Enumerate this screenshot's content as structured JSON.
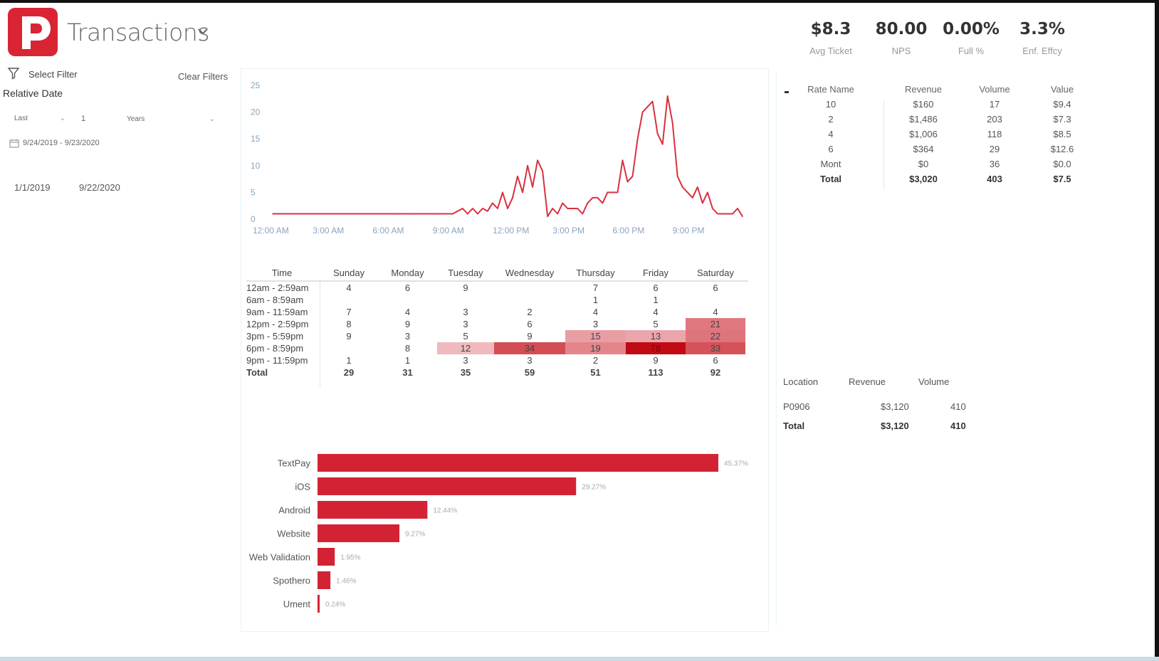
{
  "header": {
    "title": "Transactions",
    "brand_color": "#d92434",
    "logo_icon": "p-logo-icon",
    "chevron_icon": "chevron-down-icon"
  },
  "kpis": [
    {
      "value": "$8.3",
      "label": "Avg Ticket"
    },
    {
      "value": "80.00",
      "label": "NPS"
    },
    {
      "value": "0.00%",
      "label": "Full %"
    },
    {
      "value": "3.3%",
      "label": "Enf. Effcy"
    }
  ],
  "filters": {
    "select_filter_label": "Select Filter",
    "clear_filters_label": "Clear Filters",
    "relative_date_label": "Relative Date",
    "last_select": "Last",
    "count_value": "1",
    "unit_select": "Years",
    "date_range": "9/24/2019 - 9/23/2020",
    "start_date": "1/1/2019",
    "end_date": "9/22/2020"
  },
  "chart_data": [
    {
      "type": "line",
      "title": "",
      "xlabel": "",
      "ylabel": "",
      "color": "#d9303f",
      "ylim": [
        0,
        25
      ],
      "y_ticks": [
        "0",
        "5",
        "10",
        "15",
        "20",
        "25"
      ],
      "x_ticks": [
        "12:00 AM",
        "3:00 AM",
        "6:00 AM",
        "9:00 AM",
        "12:00 PM",
        "3:00 PM",
        "6:00 PM",
        "9:00 PM"
      ],
      "x_tick_hours": [
        0,
        3,
        6,
        9,
        12,
        15,
        18,
        21
      ],
      "x": [
        0,
        1,
        2,
        3,
        4,
        5,
        6,
        7,
        8,
        8.5,
        9,
        9.25,
        9.5,
        9.75,
        10,
        10.25,
        10.5,
        10.75,
        11,
        11.25,
        11.5,
        11.75,
        12,
        12.25,
        12.5,
        12.75,
        13,
        13.25,
        13.5,
        13.75,
        14,
        14.25,
        14.5,
        14.75,
        15,
        15.25,
        15.5,
        15.75,
        16,
        16.25,
        16.5,
        16.75,
        17,
        17.25,
        17.5,
        17.75,
        18,
        18.25,
        18.5,
        18.75,
        19,
        19.25,
        19.5,
        19.75,
        20,
        20.25,
        20.5,
        20.75,
        21,
        21.25,
        21.5,
        21.75,
        22,
        22.25,
        22.5,
        22.75,
        23,
        23.25,
        23.5
      ],
      "y": [
        1,
        1,
        1,
        1,
        1,
        1,
        1,
        1,
        1,
        1,
        1,
        1.5,
        2,
        1,
        2,
        1,
        2,
        1.5,
        3,
        2,
        5,
        2,
        4,
        8,
        5,
        10,
        6,
        11,
        9,
        0.5,
        2,
        1,
        3,
        2,
        2,
        2,
        1,
        3,
        4,
        4,
        3,
        5,
        5,
        5,
        11,
        7,
        8,
        15,
        20,
        21,
        22,
        16,
        14,
        23,
        18,
        8,
        6,
        5,
        4,
        6,
        3,
        5,
        2,
        1,
        1,
        1,
        1,
        2,
        0.5
      ]
    },
    {
      "type": "table",
      "columns": [
        "Time",
        "Sunday",
        "Monday",
        "Tuesday",
        "Wednesday",
        "Thursday",
        "Friday",
        "Saturday"
      ],
      "rows": [
        {
          "time": "12am - 2:59am",
          "values": [
            "4",
            "6",
            "9",
            "",
            "7",
            "6",
            "6"
          ],
          "heat": [
            0,
            0,
            0,
            0,
            0,
            0,
            0
          ]
        },
        {
          "time": "6am - 8:59am",
          "values": [
            "",
            "",
            "",
            "",
            "1",
            "1",
            ""
          ],
          "heat": [
            0,
            0,
            0,
            0,
            0,
            0,
            0
          ]
        },
        {
          "time": "9am - 11:59am",
          "values": [
            "7",
            "4",
            "3",
            "2",
            "4",
            "4",
            "4"
          ],
          "heat": [
            0,
            0,
            0,
            0,
            0,
            0,
            0
          ]
        },
        {
          "time": "12pm - 2:59pm",
          "values": [
            "8",
            "9",
            "3",
            "6",
            "3",
            "5",
            "21"
          ],
          "heat": [
            0,
            0,
            0,
            0,
            0,
            0,
            0.42
          ]
        },
        {
          "time": "3pm - 5:59pm",
          "values": [
            "9",
            "3",
            "5",
            "9",
            "15",
            "13",
            "22"
          ],
          "heat": [
            0,
            0,
            0,
            0,
            0.22,
            0.18,
            0.44
          ]
        },
        {
          "time": "6pm - 8:59pm",
          "values": [
            "",
            "8",
            "12",
            "34",
            "19",
            "78",
            "33"
          ],
          "heat": [
            0,
            0,
            0.08,
            0.65,
            0.35,
            1,
            0.62
          ]
        },
        {
          "time": "9pm - 11:59pm",
          "values": [
            "1",
            "1",
            "3",
            "3",
            "2",
            "9",
            "6"
          ],
          "heat": [
            0,
            0,
            0,
            0,
            0,
            0,
            0
          ]
        }
      ],
      "total": {
        "label": "Total",
        "values": [
          "29",
          "31",
          "35",
          "59",
          "51",
          "113",
          "92"
        ]
      }
    },
    {
      "type": "bar",
      "orientation": "horizontal",
      "color": "#d42235",
      "categories": [
        "TextPay",
        "iOS",
        "Android",
        "Website",
        "Web Validation",
        "Spothero",
        "Ument"
      ],
      "values": [
        45.37,
        29.27,
        12.44,
        9.27,
        1.95,
        1.46,
        0.24
      ],
      "labels": [
        "45.37%",
        "29.27%",
        "12.44%",
        "9.27%",
        "1.95%",
        "1.46%",
        "0.24%"
      ]
    }
  ],
  "rate_table": {
    "columns": [
      "Rate Name",
      "Revenue",
      "Volume",
      "Value"
    ],
    "rows": [
      [
        "10",
        "$160",
        "17",
        "$9.4"
      ],
      [
        "2",
        "$1,486",
        "203",
        "$7.3"
      ],
      [
        "4",
        "$1,006",
        "118",
        "$8.5"
      ],
      [
        "6",
        "$364",
        "29",
        "$12.6"
      ],
      [
        "Mont",
        "$0",
        "36",
        "$0.0"
      ]
    ],
    "total": [
      "Total",
      "$3,020",
      "403",
      "$7.5"
    ]
  },
  "location_table": {
    "columns": [
      "Location",
      "Revenue",
      "Volume"
    ],
    "rows": [
      [
        "P0906",
        "$3,120",
        "410"
      ]
    ],
    "total": [
      "Total",
      "$3,120",
      "410"
    ]
  }
}
